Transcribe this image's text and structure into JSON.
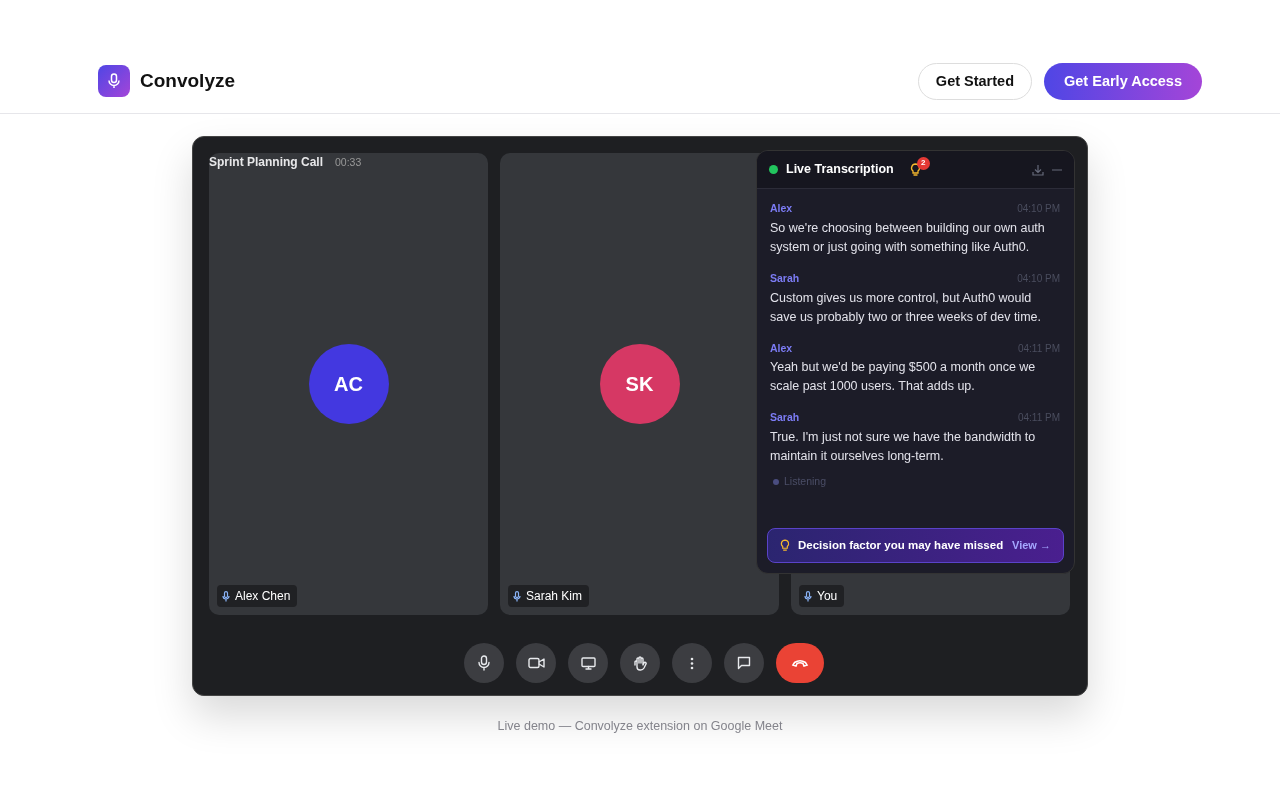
{
  "brand": {
    "name": "Convolyze"
  },
  "nav_buttons": [
    {
      "label": "Get Started",
      "kind": "outline"
    },
    {
      "label": "Get Early Access",
      "kind": "gradient"
    }
  ],
  "meeting": {
    "title": "Sprint Planning Call",
    "timer": "00:33"
  },
  "participants": [
    {
      "name": "Alex Chen",
      "initials": "AC",
      "color": "#4338e0"
    },
    {
      "name": "Sarah Kim",
      "initials": "SK",
      "color": "#d63864"
    },
    {
      "name": "You"
    }
  ],
  "transcript": {
    "title": "Live Transcription",
    "badge": "2",
    "messages": [
      {
        "speaker": "Alex",
        "time": "04:10 PM",
        "text": "So we're choosing between building our own auth system or just going with something like Auth0."
      },
      {
        "speaker": "Sarah",
        "time": "04:10 PM",
        "text": "Custom gives us more control, but Auth0 would save us probably two or three weeks of dev time."
      },
      {
        "speaker": "Alex",
        "time": "04:11 PM",
        "text": "Yeah but we'd be paying $500 a month once we scale past 1000 users. That adds up."
      },
      {
        "speaker": "Sarah",
        "time": "04:11 PM",
        "text": "True. I'm just not sure we have the bandwidth to maintain it ourselves long-term."
      }
    ],
    "status": "Listening",
    "insight": {
      "text": "Decision factor you may have missed",
      "action": "View →"
    }
  },
  "controls": [
    {
      "kind": "mic"
    },
    {
      "kind": "camera"
    },
    {
      "kind": "screen"
    },
    {
      "kind": "hand"
    },
    {
      "kind": "more"
    },
    {
      "kind": "chat"
    },
    {
      "kind": "hangup"
    }
  ],
  "caption": "Live demo — Convolyze extension on Google Meet"
}
